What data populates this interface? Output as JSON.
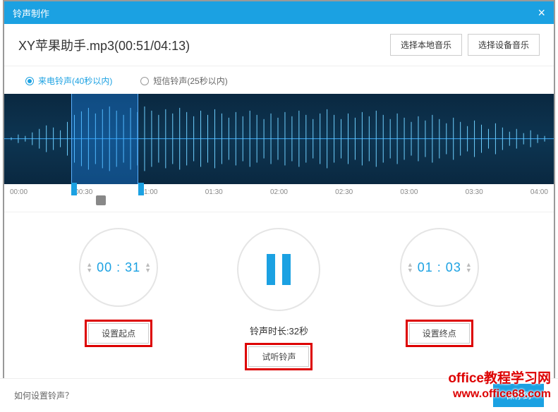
{
  "titlebar": {
    "title": "铃声制作"
  },
  "header": {
    "filename": "XY苹果助手.mp3(00:51/04:13)",
    "btn_local": "选择本地音乐",
    "btn_device": "选择设备音乐"
  },
  "radios": {
    "incoming": "来电铃声(40秒以内)",
    "sms": "短信铃声(25秒以内)"
  },
  "timeline": [
    "00:00",
    "00:30",
    "01:00",
    "01:30",
    "02:00",
    "02:30",
    "03:00",
    "03:30",
    "04:00"
  ],
  "controls": {
    "start_time": "00 : 31",
    "end_time": "01 : 03",
    "set_start": "设置起点",
    "set_end": "设置终点",
    "duration_label": "铃声时长:32秒",
    "preview": "试听铃声"
  },
  "footer": {
    "help": "如何设置铃声？",
    "save": "保存到"
  },
  "watermark": {
    "line1": "office教程学习网",
    "line2": "www.office68.com"
  }
}
